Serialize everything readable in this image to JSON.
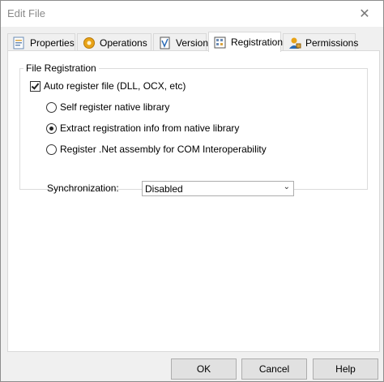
{
  "window": {
    "title": "Edit File",
    "close": "✕"
  },
  "tabs": [
    {
      "label": "Properties"
    },
    {
      "label": "Operations"
    },
    {
      "label": "Version"
    },
    {
      "label": "Registration"
    },
    {
      "label": "Permissions"
    }
  ],
  "group": {
    "label": "File Registration",
    "auto_register": {
      "label": "Auto register file (DLL, OCX, etc)",
      "checked": true
    },
    "options": [
      {
        "label": "Self register native library",
        "selected": false
      },
      {
        "label": "Extract registration info from native library",
        "selected": true
      },
      {
        "label": "Register .Net assembly for COM Interoperability",
        "selected": false
      }
    ],
    "sync": {
      "label": "Synchronization:",
      "value": "Disabled",
      "arrow": "⌄"
    }
  },
  "buttons": {
    "ok": "OK",
    "cancel": "Cancel",
    "help": "Help"
  },
  "colors": {
    "accent": "#0078d7",
    "panel_bg": "#ffffff",
    "frame_bg": "#f0f0f0"
  }
}
